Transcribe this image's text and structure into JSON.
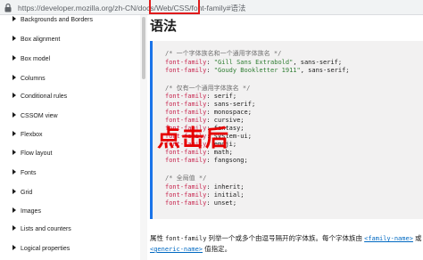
{
  "url_bar": {
    "url": "https://developer.mozilla.org/zh-CN/docs/Web/CSS/font-family#语法"
  },
  "sidebar": {
    "items": [
      {
        "label": "Backgrounds and Borders"
      },
      {
        "label": "Box alignment"
      },
      {
        "label": "Box model"
      },
      {
        "label": "Columns"
      },
      {
        "label": "Conditional rules"
      },
      {
        "label": "CSSOM view"
      },
      {
        "label": "Flexbox"
      },
      {
        "label": "Flow layout"
      },
      {
        "label": "Fonts"
      },
      {
        "label": "Grid"
      },
      {
        "label": "Images"
      },
      {
        "label": "Lists and counters"
      },
      {
        "label": "Logical properties"
      }
    ]
  },
  "main": {
    "heading": "语法",
    "code": {
      "c1": "/* 一个字体族名和一个通用字体族名 */",
      "l1_prop": "font-family",
      "l1_str": "\"Gill Sans Extrabold\"",
      "l1_rest": ", sans-serif;",
      "l2_prop": "font-family",
      "l2_str": "\"Goudy Bookletter 1911\"",
      "l2_rest": ", sans-serif;",
      "c2": "/* 仅有一个通用字体族名 */",
      "g1": "serif;",
      "g2": "sans-serif;",
      "g3": "monospace;",
      "g4": "cursive;",
      "g5": "fantasy;",
      "g6": "system-ui;",
      "g7": "emoji;",
      "g8": "math;",
      "g9": "fangsong;",
      "c3": "/* 全局值 */",
      "k1": "inherit;",
      "k2": "initial;",
      "k3": "unset;",
      "prop": "font-family",
      "colon": ": "
    },
    "overlay_label": "点击后",
    "para_line1_a": "属性 ",
    "para_line1_code": "font-family",
    "para_line1_b": " 列举一个或多个由逗号隔开的字体族。每个字体族由 ",
    "para_link1": "<family-name>",
    "para_line1_c": " 或",
    "para_link2": "<generic-name>",
    "para_line2_b": " 值指定。"
  }
}
